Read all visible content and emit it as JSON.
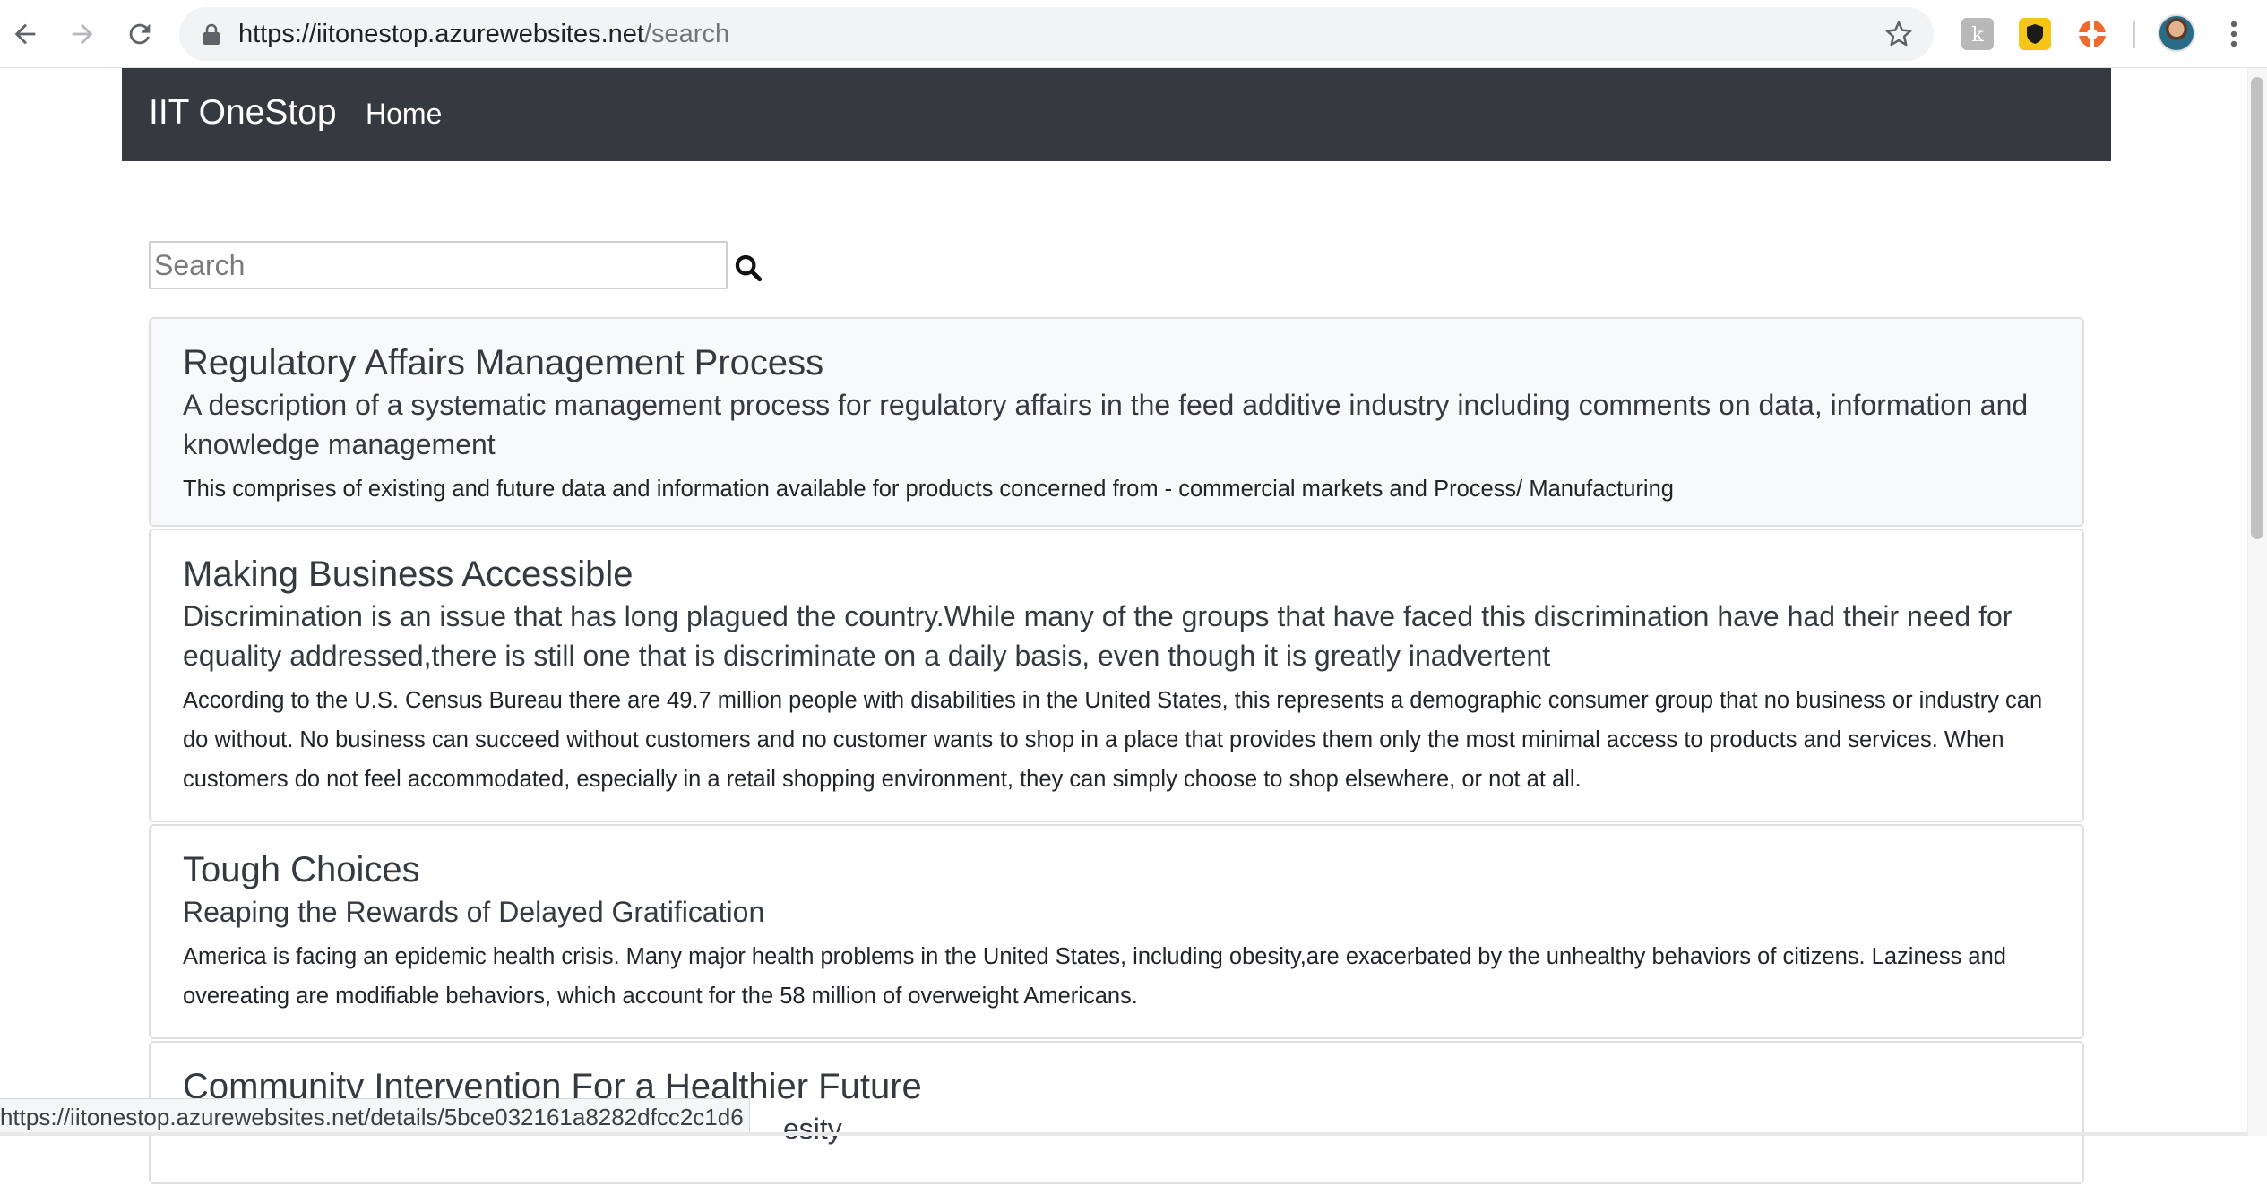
{
  "browser": {
    "url_host": "https://iitonestop.azurewebsites.net",
    "url_path": "/search",
    "status_url": "https://iitonestop.azurewebsites.net/details/5bce032161a8282dfcc2c1d6"
  },
  "navbar": {
    "brand": "IIT OneStop",
    "home_label": "Home",
    "background": "#343a40"
  },
  "search": {
    "placeholder": "Search",
    "value": ""
  },
  "results": [
    {
      "title": "Regulatory Affairs Management Process",
      "subtitle": "A description of a systematic management process for regulatory affairs in the feed additive industry including comments on data, information and knowledge management",
      "text": "This comprises of existing and future data and information available for products concerned from - commercial markets and Process/ Manufacturing"
    },
    {
      "title": "Making Business Accessible",
      "subtitle": "Discrimination is an issue that has long plagued the country.While many of the groups that have faced this discrimination have had their need for equality addressed,there is still one that is discriminate on a daily basis, even though it is greatly inadvertent",
      "text": "According to the U.S. Census Bureau there are 49.7 million people with disabilities in the United States, this represents a demographic consumer group that no business or industry can do without. No business can succeed without customers and no customer wants to shop in a place that provides them only the most minimal access to products and services. When customers do not feel accommodated, especially in a retail shopping environment, they can simply choose to shop elsewhere, or not at all."
    },
    {
      "title": "Tough Choices",
      "subtitle": "Reaping the Rewards of Delayed Gratification",
      "text": "America is facing an epidemic health crisis. Many major health problems in the United States, including obesity,are exacerbated by the unhealthy behaviors of citizens. Laziness and overeating are modifiable behaviors, which account for the 58 million of overweight Americans."
    },
    {
      "title": "Community Intervention For a Healthier Future",
      "subtitle": "esity"
    }
  ]
}
